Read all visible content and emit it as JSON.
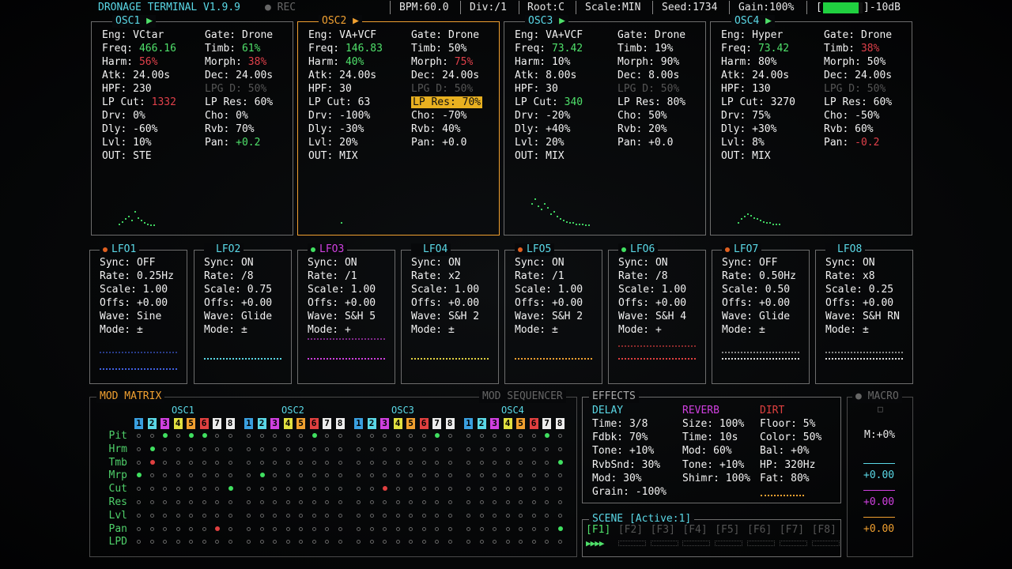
{
  "header": {
    "title": "DRONAGE TERMINAL V1.9.9",
    "rec": "REC",
    "bpm": "BPM:60.0",
    "div": "Div:/1",
    "root": "Root:C",
    "scale": "Scale:MIN",
    "seed": "Seed:1734",
    "gain": "Gain:100%",
    "meter_level": 0.9,
    "db": "]-10dB",
    "bracket_open": "["
  },
  "osc": [
    {
      "name": "OSC1",
      "arrow": "▶",
      "left": [
        [
          "Eng:",
          "VCtar",
          "w"
        ],
        [
          "Freq:",
          "466.16",
          "g"
        ],
        [
          "Harm:",
          "56%",
          "r"
        ],
        [
          "Atk:",
          "24.00s",
          "w"
        ],
        [
          "HPF:",
          "230",
          "w"
        ],
        [
          "LP Cut:",
          "1332",
          "r"
        ],
        [
          "Drv:",
          "0%",
          "w"
        ],
        [
          "Dly:",
          "-60%",
          "w"
        ],
        [
          "Lvl:",
          "10%",
          "w"
        ],
        [
          "OUT:",
          "STE",
          "w"
        ]
      ],
      "right": [
        [
          "Gate:",
          "Drone",
          "w"
        ],
        [
          "Timb:",
          "61%",
          "g"
        ],
        [
          "Morph:",
          "38%",
          "r"
        ],
        [
          "Dec:",
          "24.00s",
          "w"
        ],
        [
          "LPG D:",
          "50%",
          "d"
        ],
        [
          "LP Res:",
          "60%",
          "w"
        ],
        [
          "Cho:",
          "0%",
          "w"
        ],
        [
          "Rvb:",
          "70%",
          "w"
        ],
        [
          "Pan:",
          "+0.2",
          "g"
        ]
      ]
    },
    {
      "name": "OSC2",
      "arrow": "▶",
      "left": [
        [
          "Eng:",
          "VA+VCF",
          "w"
        ],
        [
          "Freq:",
          "146.83",
          "g"
        ],
        [
          "Harm:",
          "40%",
          "g"
        ],
        [
          "Atk:",
          "24.00s",
          "w"
        ],
        [
          "HPF:",
          "30",
          "w"
        ],
        [
          "LP Cut:",
          "63",
          "w"
        ],
        [
          "Drv:",
          "-100%",
          "w"
        ],
        [
          "Dly:",
          "-30%",
          "w"
        ],
        [
          "Lvl:",
          "20%",
          "w"
        ],
        [
          "OUT:",
          "MIX",
          "w"
        ]
      ],
      "right": [
        [
          "Gate:",
          "Drone",
          "w"
        ],
        [
          "Timb:",
          "50%",
          "w"
        ],
        [
          "Morph:",
          "75%",
          "r"
        ],
        [
          "Dec:",
          "24.00s",
          "w"
        ],
        [
          "LPG D:",
          "50%",
          "d"
        ],
        [
          "LP Res:",
          "70%",
          "h"
        ],
        [
          "Cho:",
          "-70%",
          "w"
        ],
        [
          "Rvb:",
          "40%",
          "w"
        ],
        [
          "Pan:",
          "+0.0",
          "w"
        ]
      ]
    },
    {
      "name": "OSC3",
      "arrow": "▶",
      "left": [
        [
          "Eng:",
          "VA+VCF",
          "w"
        ],
        [
          "Freq:",
          "73.42",
          "g"
        ],
        [
          "Harm:",
          "10%",
          "w"
        ],
        [
          "Atk:",
          "8.00s",
          "w"
        ],
        [
          "HPF:",
          "30",
          "w"
        ],
        [
          "LP Cut:",
          "340",
          "g"
        ],
        [
          "Drv:",
          "-20%",
          "w"
        ],
        [
          "Dly:",
          "+40%",
          "w"
        ],
        [
          "Lvl:",
          "20%",
          "w"
        ],
        [
          "OUT:",
          "MIX",
          "w"
        ]
      ],
      "right": [
        [
          "Gate:",
          "Drone",
          "w"
        ],
        [
          "Timb:",
          "19%",
          "w"
        ],
        [
          "Morph:",
          "90%",
          "w"
        ],
        [
          "Dec:",
          "8.00s",
          "w"
        ],
        [
          "LPG D:",
          "50%",
          "d"
        ],
        [
          "LP Res:",
          "80%",
          "w"
        ],
        [
          "Cho:",
          "50%",
          "w"
        ],
        [
          "Rvb:",
          "20%",
          "w"
        ],
        [
          "Pan:",
          "+0.0",
          "w"
        ]
      ]
    },
    {
      "name": "OSC4",
      "arrow": "▶",
      "left": [
        [
          "Eng:",
          "Hyper",
          "w"
        ],
        [
          "Freq:",
          "73.42",
          "g"
        ],
        [
          "Harm:",
          "80%",
          "w"
        ],
        [
          "Atk:",
          "24.00s",
          "w"
        ],
        [
          "HPF:",
          "130",
          "w"
        ],
        [
          "LP Cut:",
          "3270",
          "w"
        ],
        [
          "Drv:",
          "75%",
          "w"
        ],
        [
          "Dly:",
          "+30%",
          "w"
        ],
        [
          "Lvl:",
          "8%",
          "w"
        ],
        [
          "OUT:",
          "MIX",
          "w"
        ]
      ],
      "right": [
        [
          "Gate:",
          "Drone",
          "w"
        ],
        [
          "Timb:",
          "38%",
          "r"
        ],
        [
          "Morph:",
          "50%",
          "w"
        ],
        [
          "Dec:",
          "24.00s",
          "w"
        ],
        [
          "LPG D:",
          "50%",
          "d"
        ],
        [
          "LP Res:",
          "60%",
          "w"
        ],
        [
          "Cho:",
          "-50%",
          "w"
        ],
        [
          "Rvb:",
          "60%",
          "w"
        ],
        [
          "Pan:",
          "-0.2",
          "r"
        ]
      ]
    }
  ],
  "lfo": [
    {
      "name": "LFO1",
      "dot": "#e06020",
      "title_color": "#5ad8e6",
      "sync": "OFF",
      "rate": "0.25Hz",
      "scale": "1.00",
      "offs": "+0.00",
      "wave": "Sine",
      "mode": "±",
      "line": "#4060e0"
    },
    {
      "name": "LFO2",
      "dot": "",
      "title_color": "#5ad8e6",
      "sync": "ON",
      "rate": "/8",
      "scale": "0.75",
      "offs": "+0.00",
      "wave": "Glide",
      "mode": "±",
      "line": "#5ad8e6"
    },
    {
      "name": "LFO3",
      "dot": "#40e060",
      "title_color": "#d040e0",
      "sync": "ON",
      "rate": "/1",
      "scale": "1.00",
      "offs": "+0.00",
      "wave": "S&H 5",
      "mode": "+",
      "line": "#d040e0"
    },
    {
      "name": "LFO4",
      "dot": "",
      "title_color": "#5ad8e6",
      "sync": "ON",
      "rate": "x2",
      "scale": "1.00",
      "offs": "+0.00",
      "wave": "S&H 2",
      "mode": "±",
      "line": "#e0d040"
    },
    {
      "name": "LFO5",
      "dot": "#e06020",
      "title_color": "#5ad8e6",
      "sync": "ON",
      "rate": "/1",
      "scale": "1.00",
      "offs": "+0.00",
      "wave": "S&H 2",
      "mode": "±",
      "line": "#f0a030"
    },
    {
      "name": "LFO6",
      "dot": "#40e060",
      "title_color": "#5ad8e6",
      "sync": "ON",
      "rate": "/8",
      "scale": "1.00",
      "offs": "+0.00",
      "wave": "S&H 4",
      "mode": "+",
      "line": "#e04040"
    },
    {
      "name": "LFO7",
      "dot": "#e06020",
      "title_color": "#5ad8e6",
      "sync": "OFF",
      "rate": "0.50Hz",
      "scale": "0.50",
      "offs": "+0.00",
      "wave": "Glide",
      "mode": "±",
      "line": "#dddddd"
    },
    {
      "name": "LFO8",
      "dot": "",
      "title_color": "#5ad8e6",
      "sync": "ON",
      "rate": "x8",
      "scale": "0.25",
      "offs": "+0.00",
      "wave": "S&H RN",
      "mode": "±",
      "line": "#dddddd"
    }
  ],
  "lfo_labels": {
    "sync": "Sync:",
    "rate": "Rate:",
    "scale": "Scale:",
    "offs": "Offs:",
    "wave": "Wave:",
    "mode": "Mode:"
  },
  "mod_matrix": {
    "title": "MOD MATRIX",
    "sequencer_title": "MOD SEQUENCER",
    "osc_labels": [
      "OSC1",
      "OSC2",
      "OSC3",
      "OSC4"
    ],
    "nums": [
      "1",
      "2",
      "3",
      "4",
      "5",
      "6",
      "7",
      "8"
    ],
    "num_colors": [
      "#3aa0e0",
      "#5ad8e6",
      "#d040e0",
      "#e0e040",
      "#f0a030",
      "#e04040",
      "#eeeeee",
      "#eeeeee"
    ],
    "rows": [
      "Pit",
      "Hrm",
      "Tmb",
      "Mrp",
      "Cut",
      "Res",
      "Lvl",
      "Pan",
      "LPD"
    ],
    "active": [
      {
        "r": 0,
        "c": 2,
        "color": "#40e060"
      },
      {
        "r": 0,
        "c": 4,
        "color": "#40e060"
      },
      {
        "r": 0,
        "c": 5,
        "color": "#40e060"
      },
      {
        "r": 0,
        "c": 13,
        "color": "#40e060"
      },
      {
        "r": 0,
        "c": 22,
        "color": "#40e060"
      },
      {
        "r": 0,
        "c": 30,
        "color": "#40e060"
      },
      {
        "r": 1,
        "c": 1,
        "color": "#40e060"
      },
      {
        "r": 2,
        "c": 1,
        "color": "#e04040"
      },
      {
        "r": 2,
        "c": 31,
        "color": "#40e060"
      },
      {
        "r": 3,
        "c": 0,
        "color": "#40e060"
      },
      {
        "r": 3,
        "c": 9,
        "color": "#40e060"
      },
      {
        "r": 4,
        "c": 7,
        "color": "#40e060"
      },
      {
        "r": 4,
        "c": 18,
        "color": "#e04040"
      },
      {
        "r": 7,
        "c": 6,
        "color": "#e04040"
      },
      {
        "r": 7,
        "c": 31,
        "color": "#40e060"
      }
    ]
  },
  "effects": {
    "title": "EFFECTS",
    "delay": {
      "title": "DELAY",
      "rows": [
        [
          "Time:",
          "3/8"
        ],
        [
          "Fdbk:",
          "70%"
        ],
        [
          "Tone:",
          "+10%"
        ],
        [
          "RvbSnd:",
          "30%"
        ],
        [
          "Mod:",
          "30%"
        ],
        [
          "Grain:",
          "-100%"
        ]
      ]
    },
    "reverb": {
      "title": "REVERB",
      "rows": [
        [
          "Size:",
          "100%"
        ],
        [
          "Time:",
          "10s"
        ],
        [
          "Mod:",
          "60%"
        ],
        [
          "Tone:",
          "+10%"
        ],
        [
          "Shimr:",
          "100%"
        ]
      ]
    },
    "dirt": {
      "title": "DIRT",
      "rows": [
        [
          "Floor:",
          "5%"
        ],
        [
          "Color:",
          "50%"
        ],
        [
          "Bal:",
          "+0%"
        ],
        [
          "HP:",
          "320Hz"
        ],
        [
          "Fat:",
          "80%"
        ]
      ]
    }
  },
  "macro": {
    "title": "MACRO",
    "m": "M:+0%",
    "values": [
      "+0.00",
      "+0.00",
      "+0.00"
    ],
    "colors": [
      "#5ad8e6",
      "#d040e0",
      "#f0a030"
    ]
  },
  "scene": {
    "title": "SCENE [Active:1]",
    "keys": [
      "[F1]",
      "[F2]",
      "[F3]",
      "[F4]",
      "[F5]",
      "[F6]",
      "[F7]",
      "[F8]"
    ],
    "play": "▶▶▶▶"
  },
  "colors": {
    "cyan": "#5ad8e6",
    "green": "#4fe06a",
    "red": "#e0404a",
    "orange": "#f0a030",
    "magenta": "#d040e0",
    "highlight": "#e8b020"
  }
}
